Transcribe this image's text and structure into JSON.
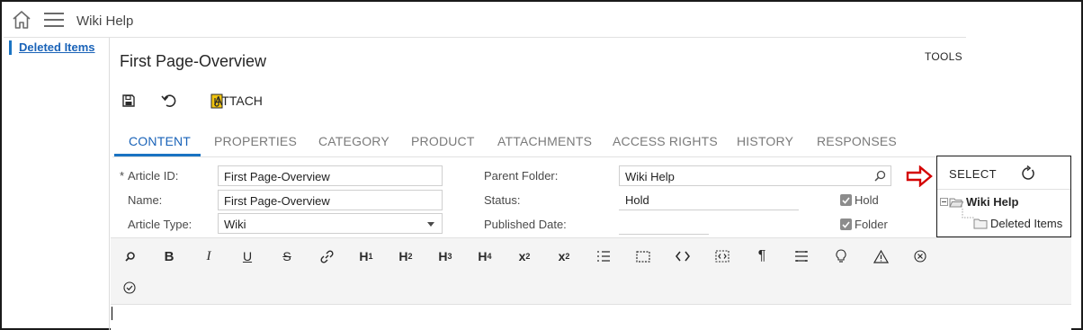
{
  "app": {
    "title": "Wiki Help"
  },
  "sidebar": {
    "items": [
      {
        "label": "Deleted Items"
      }
    ]
  },
  "header": {
    "page_title": "First Page-Overview",
    "tools_label": "TOOLS"
  },
  "toolbar": {
    "attach_label": "ATTACH"
  },
  "tabs": [
    {
      "label": "CONTENT",
      "active": true
    },
    {
      "label": "PROPERTIES"
    },
    {
      "label": "CATEGORY"
    },
    {
      "label": "PRODUCT"
    },
    {
      "label": "ATTACHMENTS"
    },
    {
      "label": "ACCESS RIGHTS"
    },
    {
      "label": "HISTORY"
    },
    {
      "label": "RESPONSES"
    }
  ],
  "form": {
    "required_mark": "*",
    "article_id": {
      "label": "Article ID:",
      "value": "First Page-Overview"
    },
    "name": {
      "label": "Name:",
      "value": "First Page-Overview"
    },
    "article_type": {
      "label": "Article Type:",
      "value": "Wiki"
    },
    "parent_folder": {
      "label": "Parent Folder:",
      "value": "Wiki Help"
    },
    "status": {
      "label": "Status:",
      "value": "Hold"
    },
    "published_date": {
      "label": "Published Date:",
      "value": ""
    },
    "hold": {
      "label": "Hold",
      "checked": true
    },
    "folder": {
      "label": "Folder",
      "checked": true
    }
  },
  "editor": {
    "buttons": {
      "h1": "H",
      "h1_sub": "1",
      "h2": "H",
      "h2_sub": "2",
      "h3": "H",
      "h3_sub": "3",
      "h4": "H",
      "h4_sub": "4",
      "subscript": "x",
      "subscript_sub": "2",
      "superscript": "x",
      "superscript_sup": "2"
    }
  },
  "tree": {
    "select_label": "SELECT",
    "nodes": [
      {
        "label": "Wiki Help",
        "expanded": true
      },
      {
        "label": "Deleted Items"
      }
    ]
  },
  "colors": {
    "accent": "#1a73c2",
    "link": "#1a63b8",
    "arrow": "#d40000"
  }
}
